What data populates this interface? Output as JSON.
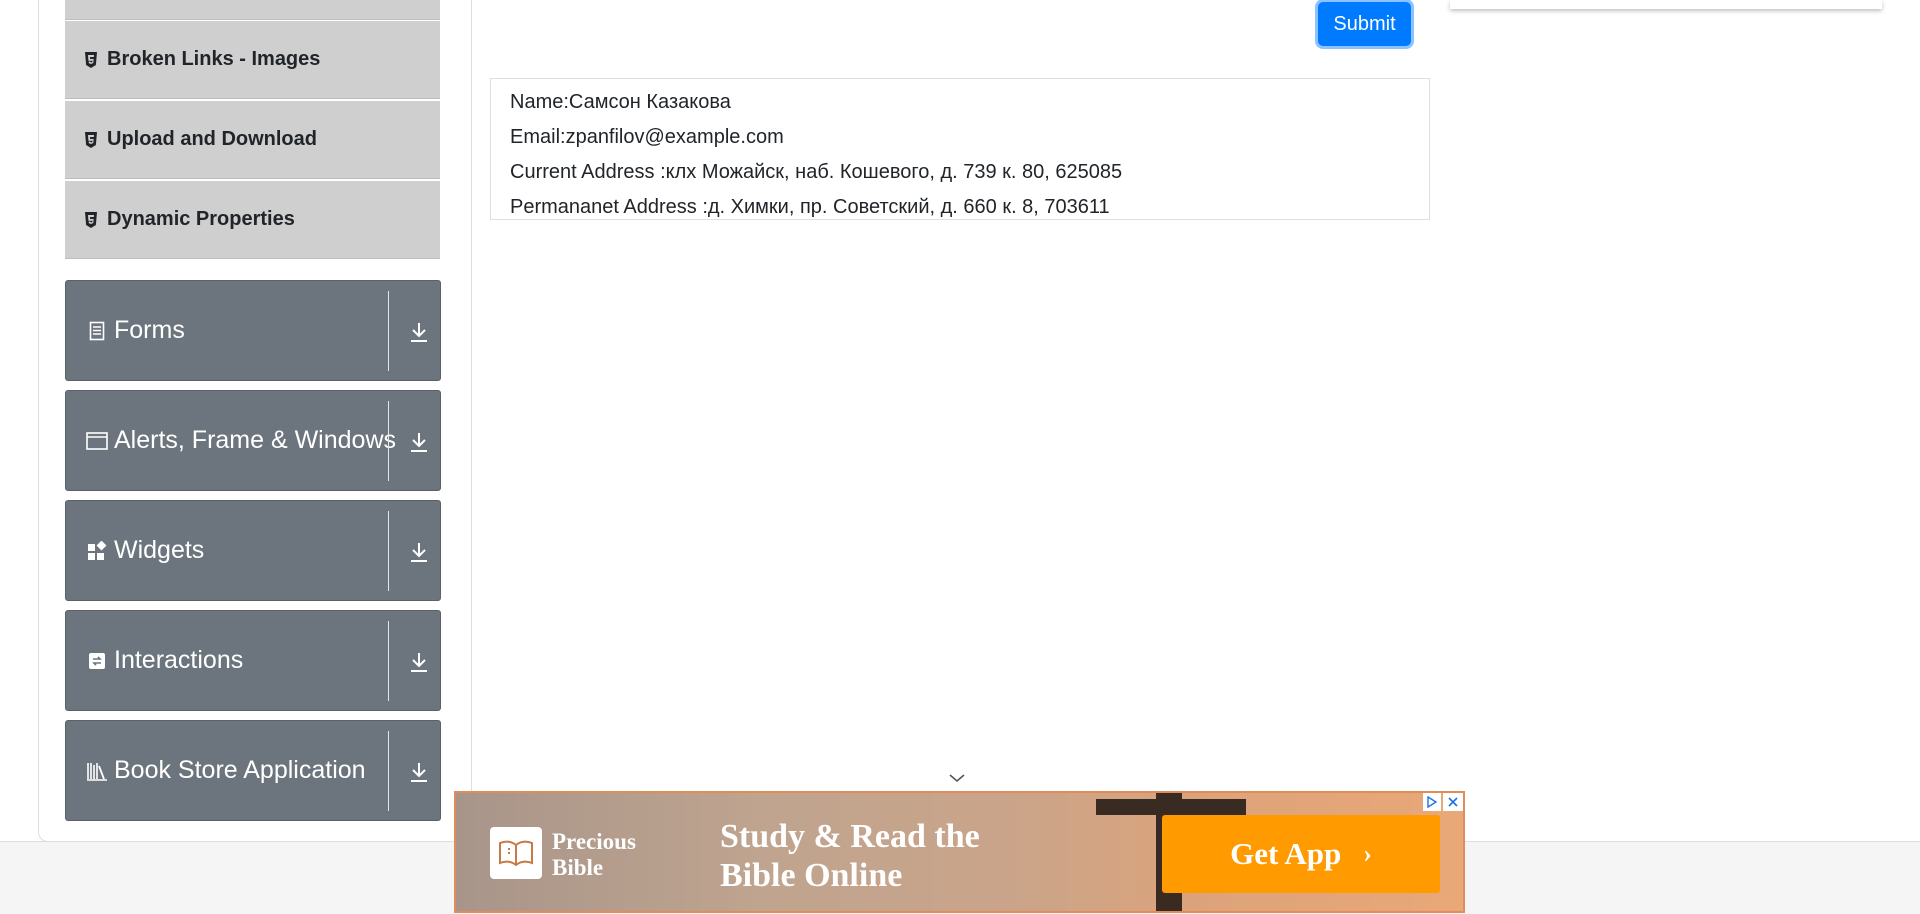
{
  "sidebar": {
    "sub_items": [
      {
        "label": "Broken Links - Images",
        "icon": "html5-icon"
      },
      {
        "label": "Upload and Download",
        "icon": "html5-icon"
      },
      {
        "label": "Dynamic Properties",
        "icon": "html5-icon"
      }
    ],
    "groups": [
      {
        "label": "Forms",
        "icon": "document-icon"
      },
      {
        "label": "Alerts, Frame & Windows",
        "icon": "window-icon"
      },
      {
        "label": "Widgets",
        "icon": "widgets-icon"
      },
      {
        "label": "Interactions",
        "icon": "interactions-icon"
      },
      {
        "label": "Book Store Application",
        "icon": "books-icon"
      }
    ]
  },
  "form": {
    "submit_label": "Submit"
  },
  "output": {
    "name": "Name:Самсон Казакова",
    "email": "Email:zpanfilov@example.com",
    "current_address": "Current Address :клх Можайск, наб. Кошевого, д. 739 к. 80, 625085",
    "permanent_address": "Permananet Address :д. Химки, пр. Советский, д. 660 к. 8, 703611"
  },
  "ad": {
    "brand_line1": "Precious",
    "brand_line2": "Bible",
    "headline_line1": "Study & Read the",
    "headline_line2": "Bible Online",
    "cta_label": "Get App",
    "accent_color": "#ff9a00"
  }
}
